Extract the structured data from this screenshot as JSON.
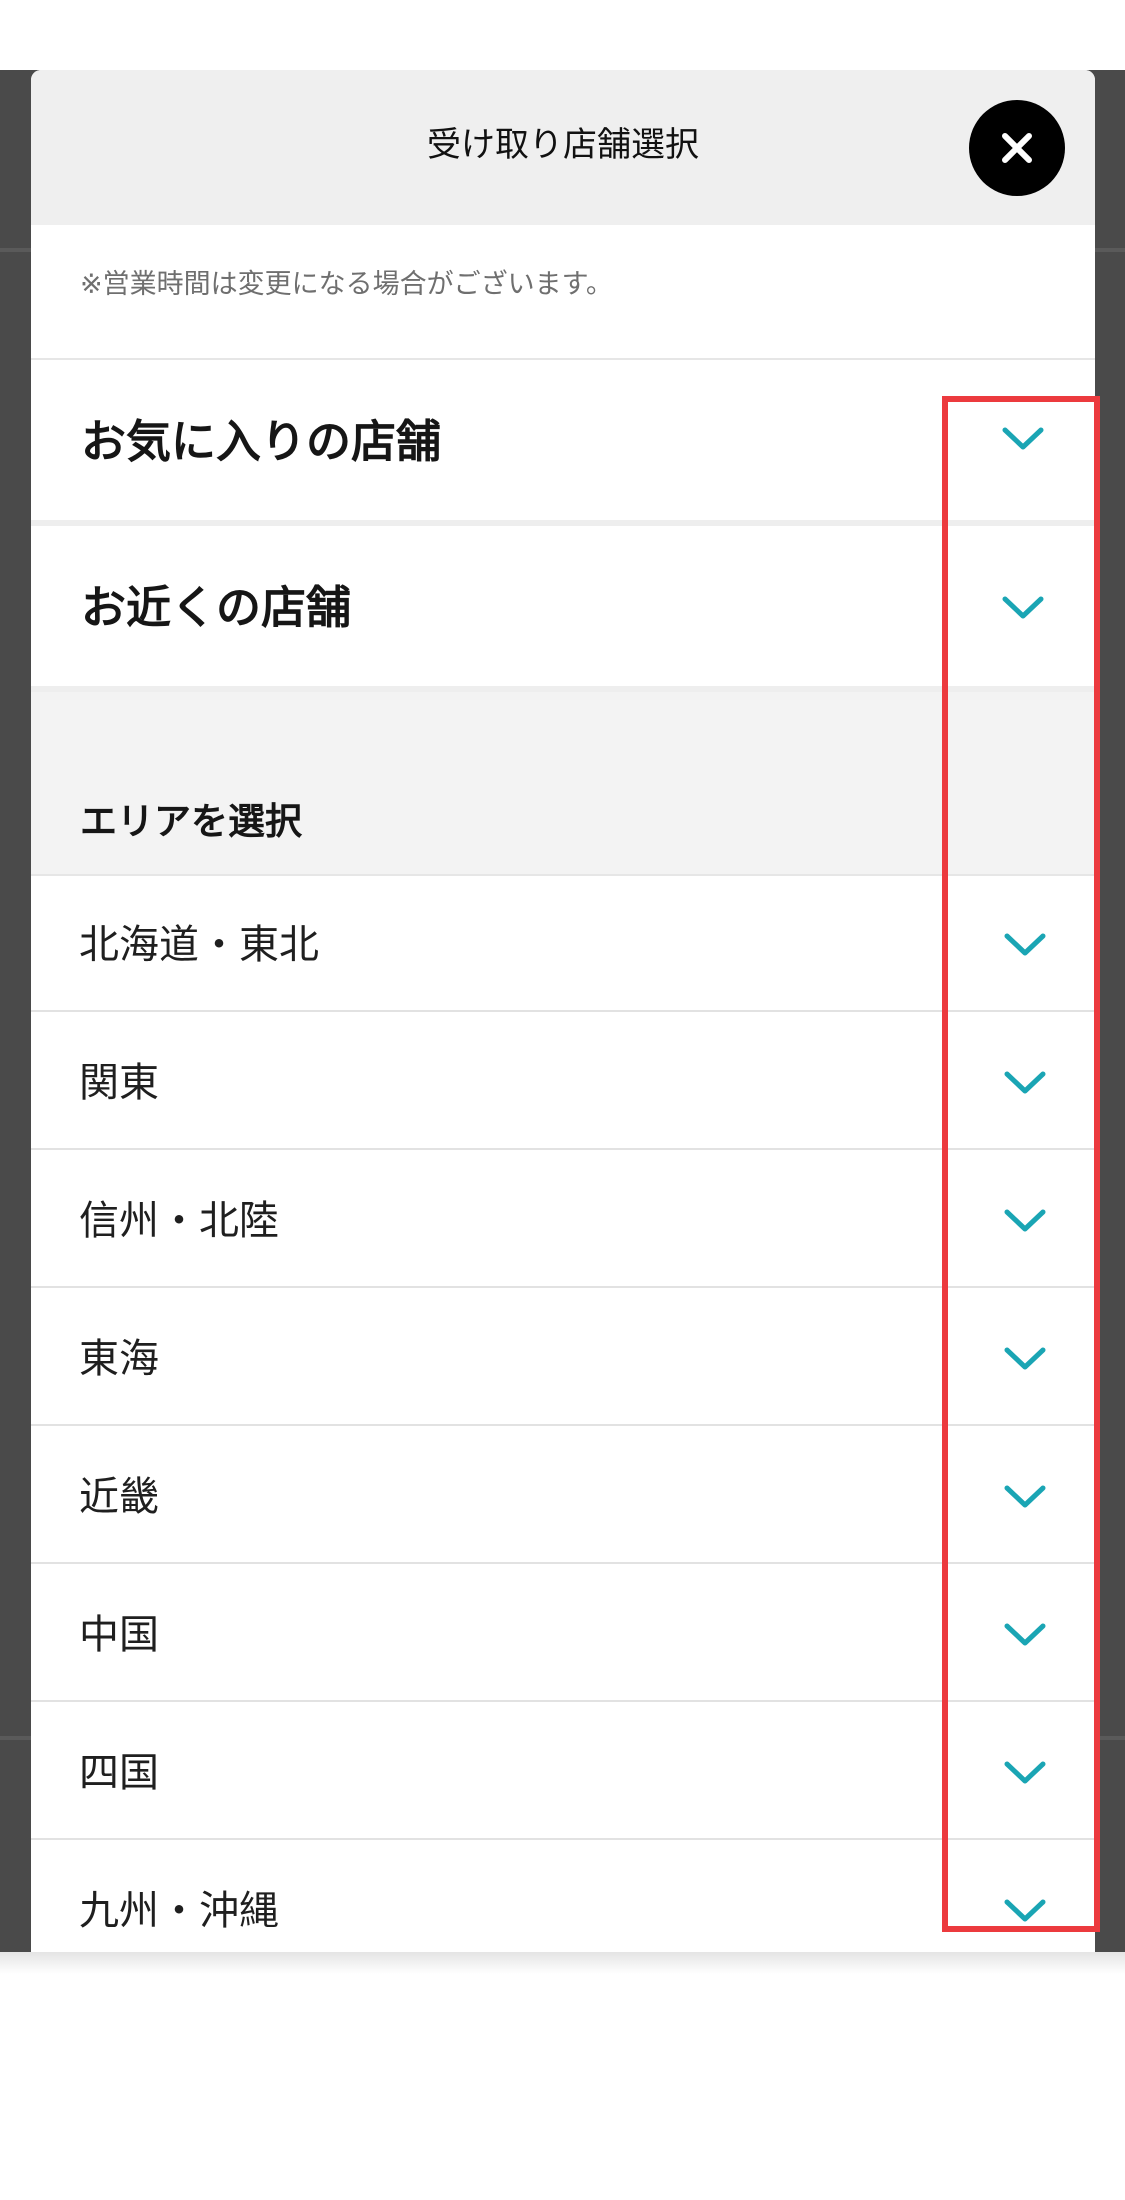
{
  "modal": {
    "title": "受け取り店舗選択",
    "close_icon": "close-icon",
    "notice": "※営業時間は変更になる場合がございます。"
  },
  "sections": [
    {
      "label": "お気に入りの店舗",
      "icon": "chevron-down-icon"
    },
    {
      "label": "お近くの店舗",
      "icon": "chevron-down-icon"
    }
  ],
  "area": {
    "heading": "エリアを選択",
    "items": [
      {
        "label": "北海道・東北",
        "icon": "chevron-down-icon"
      },
      {
        "label": "関東",
        "icon": "chevron-down-icon"
      },
      {
        "label": "信州・北陸",
        "icon": "chevron-down-icon"
      },
      {
        "label": "東海",
        "icon": "chevron-down-icon"
      },
      {
        "label": "近畿",
        "icon": "chevron-down-icon"
      },
      {
        "label": "中国",
        "icon": "chevron-down-icon"
      },
      {
        "label": "四国",
        "icon": "chevron-down-icon"
      },
      {
        "label": "九州・沖縄",
        "icon": "chevron-down-icon"
      }
    ]
  },
  "colors": {
    "accent": "#1aa5b4",
    "highlight_border": "#ec3a3e",
    "backdrop": "#4a4a4a",
    "header_bg": "#efefef"
  }
}
